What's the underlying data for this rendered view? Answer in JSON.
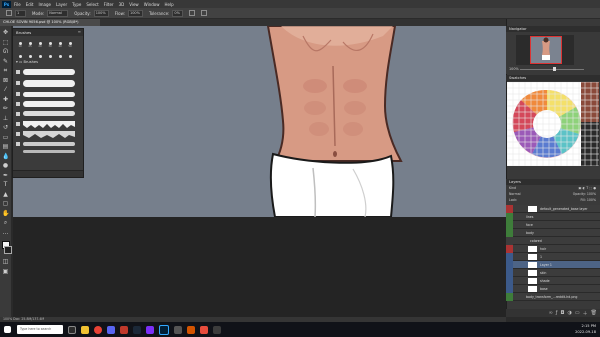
{
  "app": {
    "logo": "Ps"
  },
  "menu": [
    "File",
    "Edit",
    "Image",
    "Layer",
    "Type",
    "Select",
    "Filter",
    "3D",
    "View",
    "Window",
    "Help"
  ],
  "options": {
    "brush_size": "1",
    "mode_label": "Mode:",
    "mode_value": "Normal",
    "opacity_label": "Opacity:",
    "opacity_value": "100%",
    "flow_label": "Flow:",
    "flow_value": "100%",
    "tolerance_label": "Tolerance:",
    "tolerance_value": "0%"
  },
  "document": {
    "tab_title": "CHLOE SOVIN 9056.psd @ 100% (RGB/8*)"
  },
  "brushes_panel": {
    "title": "Brushes",
    "tip_sizes": [
      "10",
      "25",
      "20",
      "30",
      "40",
      "50",
      "",
      "",
      "",
      "",
      ""
    ],
    "folder": "Brushes"
  },
  "navigator": {
    "title": "Navigator",
    "zoom": "100%"
  },
  "swatches": {
    "title": "Swatches"
  },
  "layers": {
    "title": "Layers",
    "kind_label": "Kind",
    "blend_mode": "Normal",
    "opacity_label": "Opacity:",
    "opacity_value": "100%",
    "lock_label": "Lock:",
    "fill_label": "Fill:",
    "fill_value": "100%",
    "rows": [
      "default_generated_base layer",
      "lines",
      "face",
      "body",
      "colored",
      "hair",
      "1",
      "Layer 1",
      "skin",
      "shade",
      "base",
      "body_transform_...reddit-hd.png"
    ]
  },
  "status": {
    "text": "100%      Doc: 25.8M/137.4M"
  },
  "taskbar": {
    "search_placeholder": "Type here to search",
    "time": "2:15 PM",
    "date": "2022-09-18"
  },
  "colors": {
    "canvas_bg": "#767f8c",
    "ui_dark": "#393939",
    "layer_visible_red": "#a33",
    "layer_visible_blue": "#3c5a8a",
    "layer_visible_green": "#3e7d3a"
  }
}
